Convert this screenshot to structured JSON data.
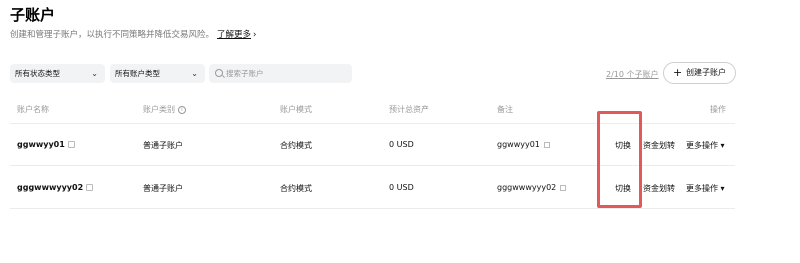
{
  "page": {
    "title": "子账户",
    "subtitle": "创建和管理子账户，以执行不同策略并降低交易风险。",
    "learn_more": "了解更多",
    "chevron": "›"
  },
  "filters": {
    "status_select": "所有状态类型",
    "account_select": "所有账户类型",
    "search_placeholder": "搜索子账户",
    "arrow": "⌄"
  },
  "summary": {
    "count_text": "2/10 个子账户",
    "create_label": "创建子账户",
    "plus": "+"
  },
  "table": {
    "headers": {
      "name": "账户名称",
      "type": "账户类别",
      "mode": "账户模式",
      "assets": "预计总资产",
      "remark": "备注",
      "actions": "操作"
    },
    "rows": [
      {
        "name": "ggwwyy01",
        "type": "普通子账户",
        "mode": "合约模式",
        "assets": "0 USD",
        "remark": "ggwwyy01",
        "switch": "切换",
        "transfer": "资金划转",
        "more": "更多操作 ▾"
      },
      {
        "name": "gggwwwyyy02",
        "type": "普通子账户",
        "mode": "合约模式",
        "assets": "0 USD",
        "remark": "gggwwwyyy02",
        "switch": "切换",
        "transfer": "资金划转",
        "more": "更多操作 ▾"
      }
    ]
  },
  "colors": {
    "highlight": "#e05a5a",
    "muted": "#999999"
  }
}
